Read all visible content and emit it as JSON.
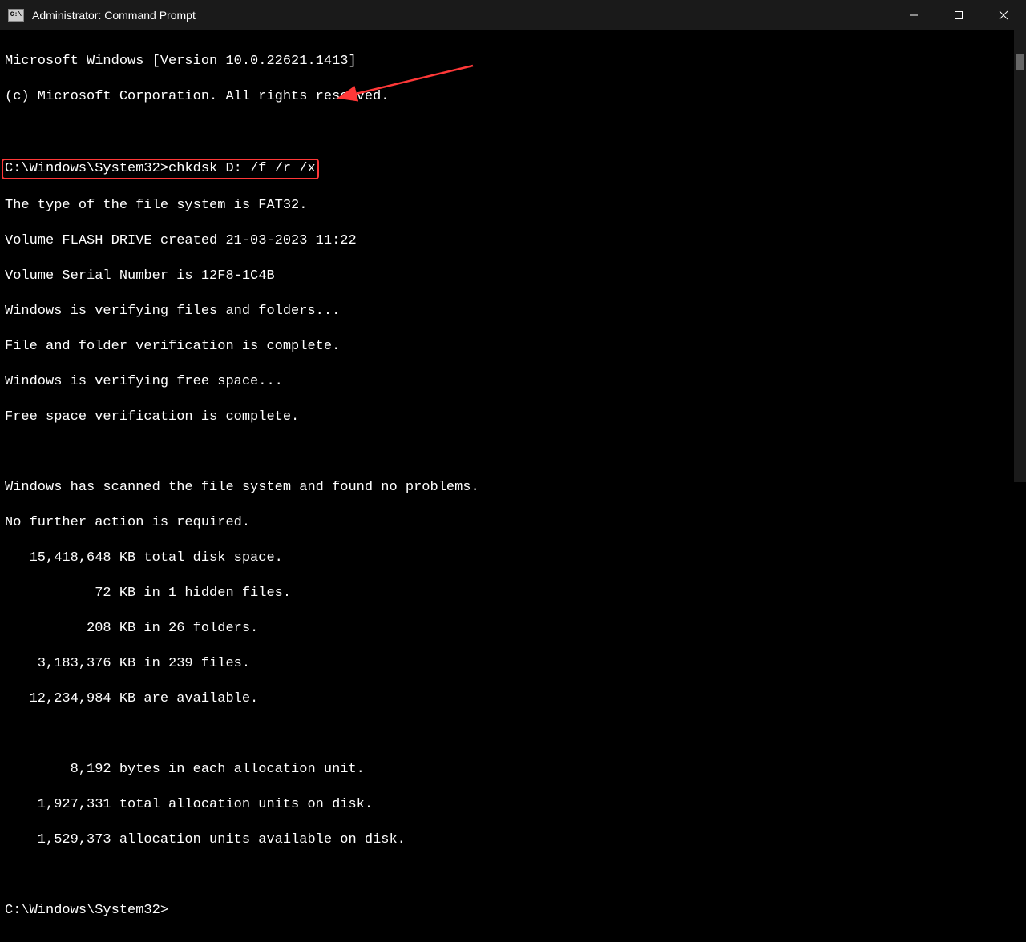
{
  "titlebar": {
    "icon_label": "C:\\",
    "title": "Administrator: Command Prompt"
  },
  "terminal": {
    "line1": "Microsoft Windows [Version 10.0.22621.1413]",
    "line2": "(c) Microsoft Corporation. All rights reserved.",
    "prompt_path": "C:\\Windows\\System32>",
    "command": "chkdsk D: /f /r /x",
    "out1": "The type of the file system is FAT32.",
    "out2": "Volume FLASH DRIVE created 21-03-2023 11:22",
    "out3": "Volume Serial Number is 12F8-1C4B",
    "out4": "Windows is verifying files and folders...",
    "out5": "File and folder verification is complete.",
    "out6": "Windows is verifying free space...",
    "out7": "Free space verification is complete.",
    "out8": "Windows has scanned the file system and found no problems.",
    "out9": "No further action is required.",
    "out10": "   15,418,648 KB total disk space.",
    "out11": "           72 KB in 1 hidden files.",
    "out12": "          208 KB in 26 folders.",
    "out13": "    3,183,376 KB in 239 files.",
    "out14": "   12,234,984 KB are available.",
    "out15": "        8,192 bytes in each allocation unit.",
    "out16": "    1,927,331 total allocation units on disk.",
    "out17": "    1,529,373 allocation units available on disk.",
    "final_prompt": "C:\\Windows\\System32>"
  }
}
